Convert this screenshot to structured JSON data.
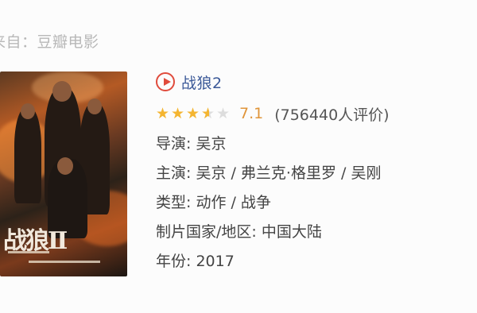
{
  "source_label": "来自：豆瓣电影",
  "movie": {
    "title": "战狼2",
    "rating": {
      "score": "7.1",
      "count": "(756440人评价)",
      "stars": 3.5,
      "star_color": "#f4b531"
    },
    "details": [
      {
        "label": "导演:",
        "value": "吴京"
      },
      {
        "label": "主演:",
        "value": "吴京 / 弗兰克·格里罗 / 吴刚"
      },
      {
        "label": "类型:",
        "value": "动作 / 战争"
      },
      {
        "label": "制片国家/地区:",
        "value": "中国大陆"
      },
      {
        "label": "年份:",
        "value": "2017"
      }
    ],
    "poster_title": "战狼Ⅱ"
  },
  "colors": {
    "title": "#3b5998",
    "play_icon": "#e04b3c",
    "score": "#e0953a"
  },
  "icons": [
    "play-circle-icon",
    "star-icon"
  ]
}
